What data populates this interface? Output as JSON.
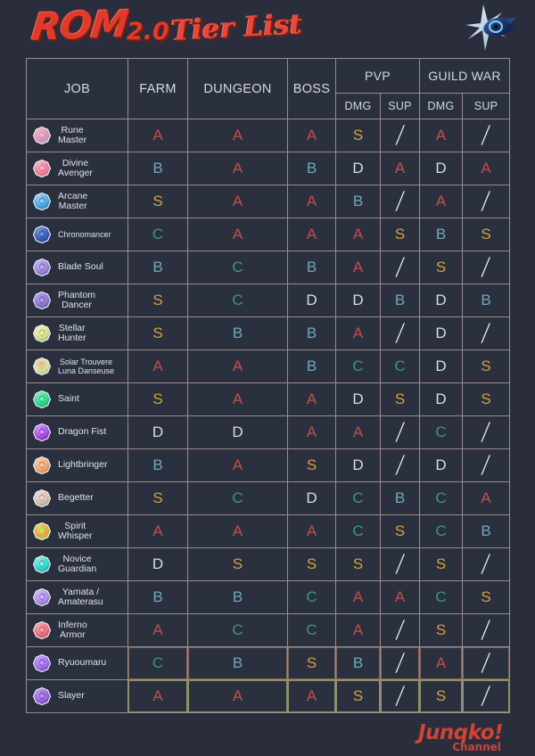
{
  "header": {
    "title_part1": "ROM",
    "title_part2": "2.0",
    "title_part3": "Tier List",
    "logo_icon": "ragnarok-logo-icon"
  },
  "footer": {
    "watermark_name": "Junqko",
    "watermark_bang": "!",
    "watermark_sub": "Channel"
  },
  "colors": {
    "background": "#2a2e3c",
    "cell_background": "#2b303f",
    "border": "#9c8b8a",
    "grade_S": "#d4a23c",
    "grade_A": "#c24f48",
    "grade_B": "#6fa8bc",
    "grade_C": "#3a9a70",
    "grade_D": "#dadce4",
    "title_red": "#e03a2a",
    "watermark_red": "#cf4436"
  },
  "table": {
    "headers": {
      "job": "JOB",
      "farm": "FARM",
      "dungeon": "DUNGEON",
      "boss": "BOSS",
      "pvp": "PVP",
      "guild_war": "GUILD WAR",
      "pvp_dmg": "DMG",
      "pvp_sup": "SUP",
      "gw_dmg": "DMG",
      "gw_sup": "SUP"
    },
    "columns": [
      "JOB",
      "FARM",
      "DUNGEON",
      "BOSS",
      "PVP DMG",
      "PVP SUP",
      "GUILD WAR DMG",
      "GUILD WAR SUP"
    ],
    "grade_legend": [
      "S",
      "A",
      "B",
      "C",
      "D",
      "/"
    ],
    "rows": [
      {
        "job": "Rune\nMaster",
        "icon": "rune-master-emblem-icon",
        "icon_colors": [
          "#e88fa8",
          "#f4b9cb",
          "#8fa8d8"
        ],
        "farm": "A",
        "dungeon": "A",
        "boss": "A",
        "pvp_dmg": "S",
        "pvp_sup": "/",
        "gw_dmg": "A",
        "gw_sup": "/"
      },
      {
        "job": "Divine\nAvenger",
        "icon": "divine-avenger-emblem-icon",
        "icon_colors": [
          "#f08098",
          "#f9c0d0",
          "#c36a8a"
        ],
        "farm": "B",
        "dungeon": "A",
        "boss": "B",
        "pvp_dmg": "D",
        "pvp_sup": "A",
        "gw_dmg": "D",
        "gw_sup": "A"
      },
      {
        "job": "Arcane\nMaster",
        "icon": "arcane-master-emblem-icon",
        "icon_colors": [
          "#4fa8e8",
          "#a8d8f4",
          "#2a6fb0"
        ],
        "farm": "S",
        "dungeon": "A",
        "boss": "A",
        "pvp_dmg": "B",
        "pvp_sup": "/",
        "gw_dmg": "A",
        "gw_sup": "/"
      },
      {
        "job": "Chronomancer",
        "icon": "chronomancer-emblem-icon",
        "icon_colors": [
          "#3a5fb8",
          "#7f9fe0",
          "#1f3a80"
        ],
        "farm": "C",
        "dungeon": "A",
        "boss": "A",
        "pvp_dmg": "A",
        "pvp_sup": "S",
        "gw_dmg": "B",
        "gw_sup": "S",
        "label_small": true
      },
      {
        "job": "Blade Soul",
        "icon": "blade-soul-emblem-icon",
        "icon_colors": [
          "#9f87d8",
          "#c8b4f0",
          "#6f54b0"
        ],
        "farm": "B",
        "dungeon": "C",
        "boss": "B",
        "pvp_dmg": "A",
        "pvp_sup": "/",
        "gw_dmg": "S",
        "gw_sup": "/"
      },
      {
        "job": "Phantom\nDancer",
        "icon": "phantom-dancer-emblem-icon",
        "icon_colors": [
          "#8f7ad0",
          "#b9a6ec",
          "#5f4aa0"
        ],
        "farm": "S",
        "dungeon": "C",
        "boss": "D",
        "pvp_dmg": "D",
        "pvp_sup": "B",
        "gw_dmg": "D",
        "gw_sup": "B"
      },
      {
        "job": "Stellar\nHunter",
        "icon": "stellar-hunter-emblem-icon",
        "icon_colors": [
          "#d8e08f",
          "#eef0c0",
          "#a8b060"
        ],
        "farm": "S",
        "dungeon": "B",
        "boss": "B",
        "pvp_dmg": "A",
        "pvp_sup": "/",
        "gw_dmg": "D",
        "gw_sup": "/"
      },
      {
        "job": "Solar Trouvere\nLuna Danseuse",
        "icon": "solar-trouvere-luna-danseuse-emblem-icon",
        "icon_colors": [
          "#d8e0a0",
          "#f0c8a8",
          "#b0b878"
        ],
        "farm": "A",
        "dungeon": "A",
        "boss": "B",
        "pvp_dmg": "C",
        "pvp_sup": "C",
        "gw_dmg": "D",
        "gw_sup": "S",
        "label_small": true
      },
      {
        "job": "Saint",
        "icon": "saint-emblem-icon",
        "icon_colors": [
          "#2fd890",
          "#8ff0c4",
          "#18a068"
        ],
        "farm": "S",
        "dungeon": "A",
        "boss": "A",
        "pvp_dmg": "D",
        "pvp_sup": "S",
        "gw_dmg": "D",
        "gw_sup": "S"
      },
      {
        "job": "Dragon Fist",
        "icon": "dragon-fist-emblem-icon",
        "icon_colors": [
          "#a84fe8",
          "#d8a0f8",
          "#7820b0"
        ],
        "farm": "D",
        "dungeon": "D",
        "boss": "A",
        "pvp_dmg": "A",
        "pvp_sup": "/",
        "gw_dmg": "C",
        "gw_sup": "/"
      },
      {
        "job": "Lightbringer",
        "icon": "lightbringer-emblem-icon",
        "icon_colors": [
          "#f0a878",
          "#f8d0b0",
          "#c07848"
        ],
        "farm": "B",
        "dungeon": "A",
        "boss": "S",
        "pvp_dmg": "D",
        "pvp_sup": "/",
        "gw_dmg": "D",
        "gw_sup": "/"
      },
      {
        "job": "Begetter",
        "icon": "begetter-emblem-icon",
        "icon_colors": [
          "#d8c0b0",
          "#f0e0d8",
          "#a89080"
        ],
        "farm": "S",
        "dungeon": "C",
        "boss": "D",
        "pvp_dmg": "C",
        "pvp_sup": "B",
        "gw_dmg": "C",
        "gw_sup": "A"
      },
      {
        "job": "Spirit\nWhisper",
        "icon": "spirit-whisper-emblem-icon",
        "icon_colors": [
          "#f0a040",
          "#e8e060",
          "#88d860"
        ],
        "farm": "A",
        "dungeon": "A",
        "boss": "A",
        "pvp_dmg": "C",
        "pvp_sup": "S",
        "gw_dmg": "C",
        "gw_sup": "B"
      },
      {
        "job": "Novice\nGuardian",
        "icon": "novice-guardian-emblem-icon",
        "icon_colors": [
          "#30d8d0",
          "#a0f0ec",
          "#18a0a0"
        ],
        "farm": "D",
        "dungeon": "S",
        "boss": "S",
        "pvp_dmg": "S",
        "pvp_sup": "/",
        "gw_dmg": "S",
        "gw_sup": "/"
      },
      {
        "job": "Yamata /\nAmaterasu",
        "icon": "yamata-amaterasu-emblem-icon",
        "icon_colors": [
          "#b090e8",
          "#d8c0f8",
          "#7858c0"
        ],
        "farm": "B",
        "dungeon": "B",
        "boss": "C",
        "pvp_dmg": "A",
        "pvp_sup": "A",
        "gw_dmg": "C",
        "gw_sup": "S"
      },
      {
        "job": "Inferno\nArmor",
        "icon": "inferno-armor-emblem-icon",
        "icon_colors": [
          "#e87080",
          "#f8b0b8",
          "#b84858"
        ],
        "farm": "A",
        "dungeon": "C",
        "boss": "C",
        "pvp_dmg": "A",
        "pvp_sup": "/",
        "gw_dmg": "S",
        "gw_sup": "/"
      },
      {
        "job": "Ryuoumaru",
        "icon": "ryuoumaru-emblem-icon",
        "icon_colors": [
          "#a070e8",
          "#c8a8f8",
          "#6840b8"
        ],
        "farm": "C",
        "dungeon": "B",
        "boss": "S",
        "pvp_dmg": "B",
        "pvp_sup": "/",
        "gw_dmg": "A",
        "gw_sup": "/"
      },
      {
        "job": "Slayer",
        "icon": "slayer-emblem-icon",
        "icon_colors": [
          "#9868e0",
          "#c0a0f0",
          "#6038a8"
        ],
        "farm": "A",
        "dungeon": "A",
        "boss": "A",
        "pvp_dmg": "S",
        "pvp_sup": "/",
        "gw_dmg": "S",
        "gw_sup": "/"
      }
    ]
  }
}
